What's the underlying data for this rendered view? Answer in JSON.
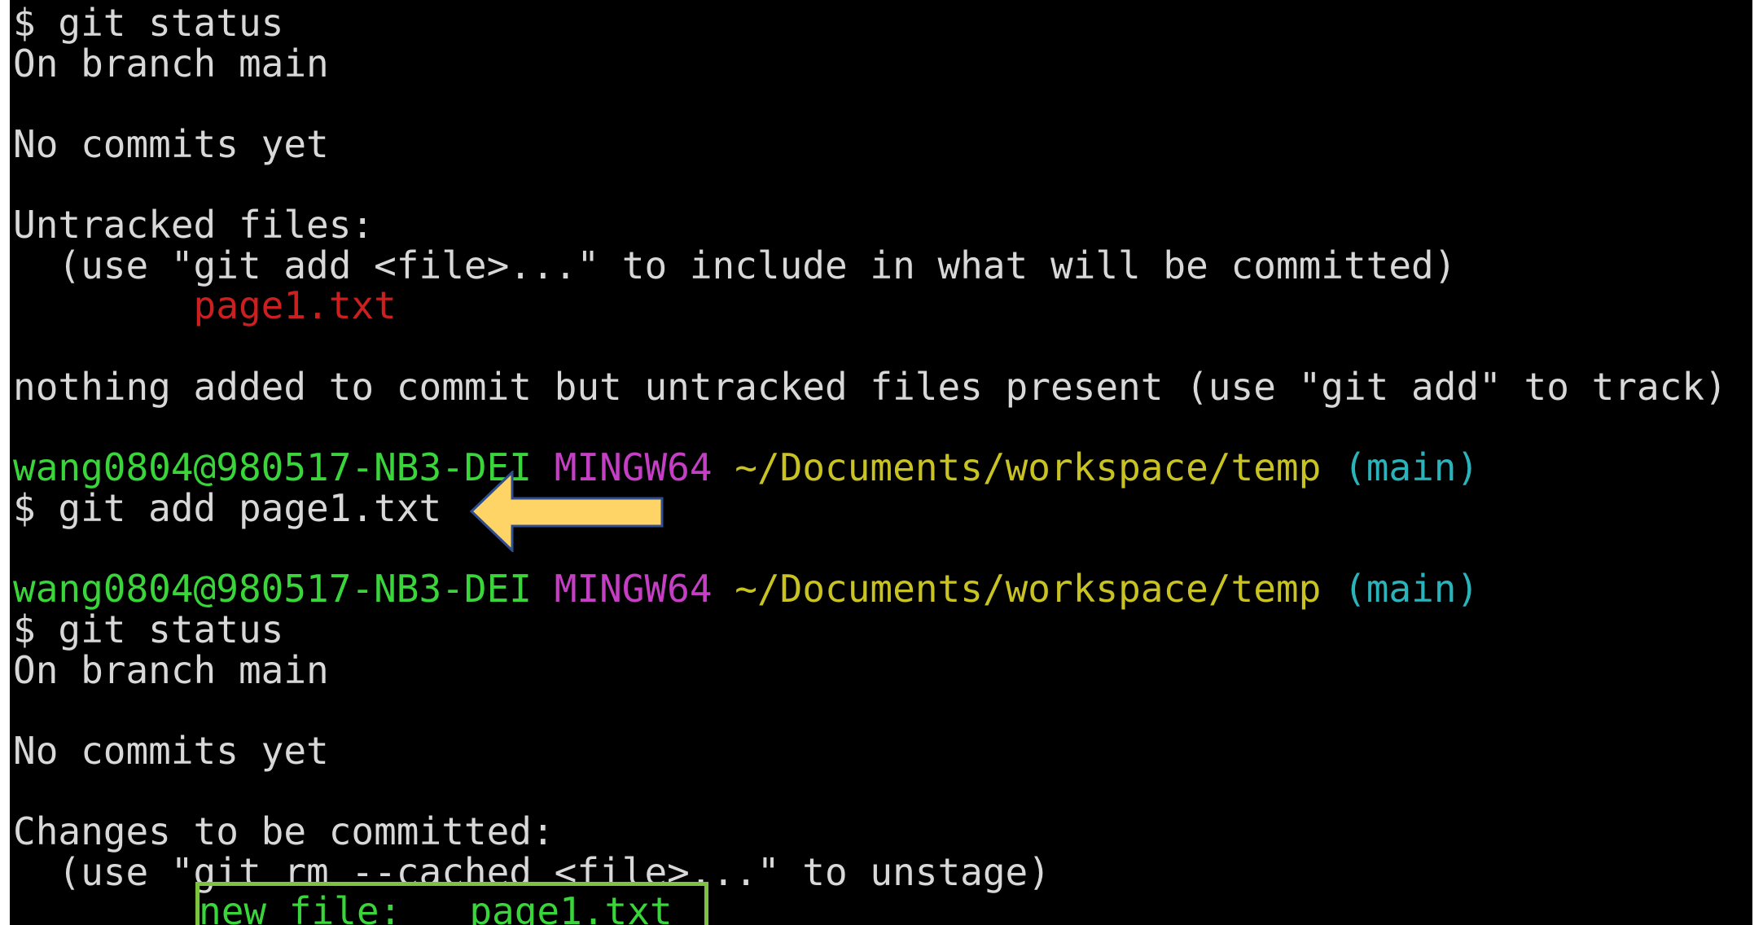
{
  "colors": {
    "background": "#000000",
    "default_text": "#d8d8d8",
    "prompt_user": "#39d53a",
    "prompt_system": "#c43fc4",
    "prompt_path": "#c8c223",
    "prompt_branch": "#2bb3bb",
    "untracked_file": "#cc1f1f",
    "staged_file": "#39d53a",
    "arrow_fill": "#ffd466",
    "arrow_stroke": "#2f4e8f",
    "highlight_border": "#7fc241"
  },
  "annotations": {
    "arrow_icon": "arrow-left-icon"
  },
  "terminal": {
    "block1": {
      "cmd": "$ git status",
      "branch": "On branch main",
      "commits": "No commits yet",
      "untracked_header": "Untracked files:",
      "untracked_hint": "  (use \"git add <file>...\" to include in what will be committed)",
      "untracked_file": "        page1.txt",
      "summary": "nothing added to commit but untracked files present (use \"git add\" to track)"
    },
    "prompt": {
      "user": "wang0804@980517-NB3-DEI",
      "system": "MINGW64",
      "path": "~/Documents/workspace/temp",
      "branch": "(main)"
    },
    "block2": {
      "cmd": "$ git add page1.txt"
    },
    "block3": {
      "cmd": "$ git status",
      "branch": "On branch main",
      "commits": "No commits yet",
      "staged_header": "Changes to be committed:",
      "staged_hint": "  (use \"git rm --cached <file>...\" to unstage)",
      "staged_file": "new file:   page1.txt"
    }
  }
}
